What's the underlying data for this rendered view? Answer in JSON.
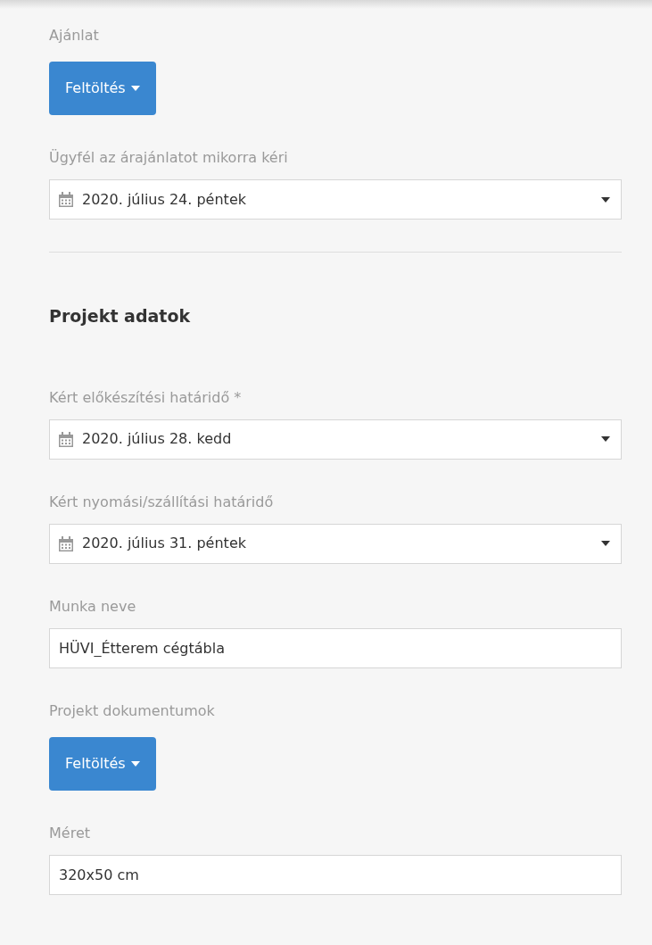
{
  "form": [
    {
      "kind": "upload",
      "label": "Ajánlat",
      "button": "Feltöltés"
    },
    {
      "kind": "date",
      "label": "Ügyfél az árajánlatot mikorra kéri",
      "value": "2020. július 24. péntek"
    },
    {
      "kind": "divider"
    },
    {
      "kind": "heading",
      "label": "Projekt adatok"
    },
    {
      "kind": "date",
      "label": "Kért előkészítési határidő *",
      "value": "2020. július 28. kedd"
    },
    {
      "kind": "date",
      "label": "Kért nyomási/szállítási határidő",
      "value": "2020. július 31. péntek"
    },
    {
      "kind": "text",
      "label": "Munka neve",
      "value": "HÜVI_Étterem cégtábla"
    },
    {
      "kind": "upload",
      "label": "Projekt dokumentumok",
      "button": "Feltöltés"
    },
    {
      "kind": "text",
      "label": "Méret",
      "value": "320x50 cm"
    }
  ]
}
